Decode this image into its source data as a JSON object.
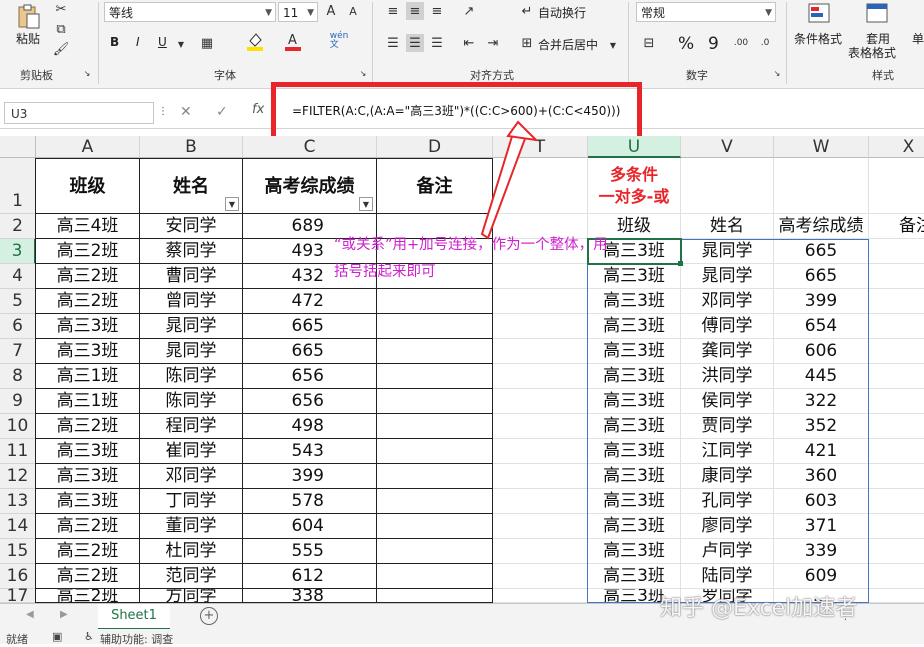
{
  "ribbon": {
    "clipboard": {
      "paste": "粘贴",
      "group": "剪贴板"
    },
    "font": {
      "name": "等线",
      "size": "11",
      "bold": "B",
      "italic": "I",
      "underline": "U",
      "group": "字体",
      "wen": "wén\n文"
    },
    "alignment": {
      "wrap": "自动换行",
      "merge": "合并后居中",
      "group": "对齐方式"
    },
    "number": {
      "format": "常规",
      "percent": "%",
      "comma": "9",
      "group": "数字"
    },
    "styles": {
      "cond": "条件格式",
      "table1": "套用",
      "table2": "表格格式",
      "cell": "单",
      "group": "样式"
    },
    "colors": {
      "font_red": "#e8262a",
      "fill_yellow": "#ffe000"
    }
  },
  "formula_bar": {
    "name_box": "U3",
    "fx": "fx",
    "formula": "=FILTER(A:C,(A:A=\"高三3班\")*((C:C>600)+(C:C<450)))"
  },
  "columns_left": [
    "A",
    "B",
    "C",
    "D"
  ],
  "columns_right": [
    "T",
    "U",
    "V",
    "W",
    "X"
  ],
  "rows": [
    "1",
    "2",
    "3",
    "4",
    "5",
    "6",
    "7",
    "8",
    "9",
    "10",
    "11",
    "12",
    "13",
    "14",
    "15",
    "16",
    "17"
  ],
  "headers": [
    "班级",
    "姓名",
    "高考综成绩",
    "备注"
  ],
  "left_table": [
    [
      "高三4班",
      "安同学",
      "689"
    ],
    [
      "高三2班",
      "蔡同学",
      "493"
    ],
    [
      "高三2班",
      "曹同学",
      "432"
    ],
    [
      "高三2班",
      "曾同学",
      "472"
    ],
    [
      "高三3班",
      "晁同学",
      "665"
    ],
    [
      "高三3班",
      "晁同学",
      "665"
    ],
    [
      "高三1班",
      "陈同学",
      "656"
    ],
    [
      "高三1班",
      "陈同学",
      "656"
    ],
    [
      "高三2班",
      "程同学",
      "498"
    ],
    [
      "高三3班",
      "崔同学",
      "543"
    ],
    [
      "高三3班",
      "邓同学",
      "399"
    ],
    [
      "高三3班",
      "丁同学",
      "578"
    ],
    [
      "高三2班",
      "董同学",
      "604"
    ],
    [
      "高三2班",
      "杜同学",
      "555"
    ],
    [
      "高三2班",
      "范同学",
      "612"
    ],
    [
      "高三2班",
      "方同学",
      "338"
    ]
  ],
  "right_title": [
    "多条件",
    "一对多-或"
  ],
  "right_headers": [
    "班级",
    "姓名",
    "高考综成绩",
    "备注"
  ],
  "right_table": [
    [
      "高三3班",
      "晁同学",
      "665"
    ],
    [
      "高三3班",
      "晁同学",
      "665"
    ],
    [
      "高三3班",
      "邓同学",
      "399"
    ],
    [
      "高三3班",
      "傅同学",
      "654"
    ],
    [
      "高三3班",
      "龚同学",
      "606"
    ],
    [
      "高三3班",
      "洪同学",
      "445"
    ],
    [
      "高三3班",
      "侯同学",
      "322"
    ],
    [
      "高三3班",
      "贾同学",
      "352"
    ],
    [
      "高三3班",
      "江同学",
      "421"
    ],
    [
      "高三3班",
      "康同学",
      "360"
    ],
    [
      "高三3班",
      "孔同学",
      "603"
    ],
    [
      "高三3班",
      "廖同学",
      "371"
    ],
    [
      "高三3班",
      "卢同学",
      "339"
    ],
    [
      "高三3班",
      "陆同学",
      "609"
    ],
    [
      "高三3班",
      "罗同学",
      "..."
    ]
  ],
  "annotation": "“或关系”用+加号连接，作为一个整体，用括号括起来即可",
  "sheet_tab": "Sheet1",
  "status": {
    "ready": "就绪",
    "accessibility": "辅助功能: 调查"
  },
  "watermark": "知乎 @Excel加速者"
}
